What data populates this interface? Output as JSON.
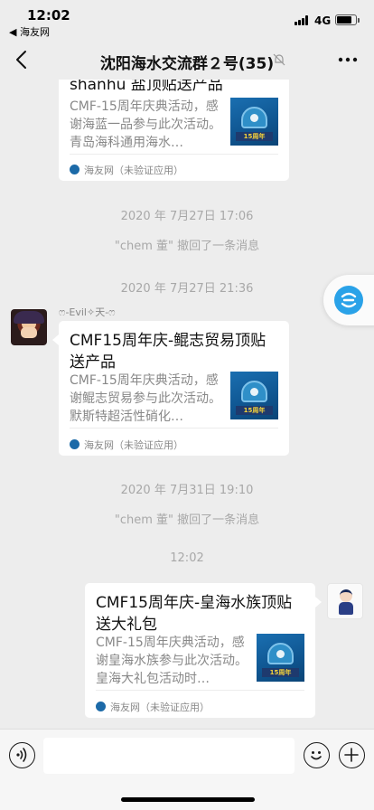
{
  "status_bar": {
    "time": "12:02",
    "back_app": "◀ 海友网",
    "network": "4G"
  },
  "navbar": {
    "title": "沈阳海水交流群２号(35)",
    "back_icon": "chevron-left-icon",
    "mute_icon": "bell-off-icon",
    "more_icon": "ellipsis-icon"
  },
  "messages": [
    {
      "type": "card",
      "side": "left",
      "title": "shanhu 盐顶贴送产品",
      "desc": "CMF-15周年庆典活动，感谢海蓝一品参与此次活动。青岛海科通用海水…",
      "thumb_text": "15周年",
      "source": "海友网（未验证应用）"
    },
    {
      "type": "time",
      "text": "2020 年 7月27日 17:06"
    },
    {
      "type": "system",
      "text": "\"chem 董\" 撤回了一条消息"
    },
    {
      "type": "time",
      "text": "2020 年 7月27日 21:36"
    },
    {
      "type": "card",
      "side": "left",
      "nickname": "ෆ-Evil✧天-ෆ",
      "title": "CMF15周年庆-鲲志贸易顶贴送产品",
      "desc": "CMF-15周年庆典活动，感谢鲲志贸易参与此次活动。默斯特超活性硝化…",
      "thumb_text": "15周年",
      "source": "海友网（未验证应用）"
    },
    {
      "type": "time",
      "text": "2020 年 7月31日 19:10"
    },
    {
      "type": "system",
      "text": "\"chem 董\" 撤回了一条消息"
    },
    {
      "type": "time",
      "text": "12:02"
    },
    {
      "type": "card",
      "side": "right",
      "title": "CMF15周年庆-皇海水族顶贴送大礼包",
      "desc": "CMF-15周年庆典活动，感谢皇海水族参与此次活动。皇海大礼包活动时…",
      "thumb_text": "15周年",
      "source": "海友网（未验证应用）"
    }
  ],
  "input_bar": {
    "voice_icon": "voice-icon",
    "emoji_icon": "emoji-icon",
    "plus_icon": "plus-icon"
  },
  "colors": {
    "background": "#ededed",
    "card": "#ffffff",
    "float_accent": "#2aa2e8"
  }
}
